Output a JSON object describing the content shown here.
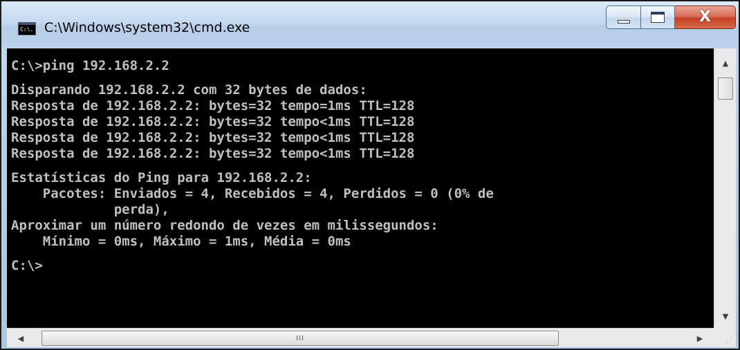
{
  "window": {
    "title": "C:\\Windows\\system32\\cmd.exe",
    "icon_label": "C:\\."
  },
  "caption_buttons": {
    "close_glyph": "X"
  },
  "console": {
    "lines": [
      "C:\\>ping 192.168.2.2",
      "",
      "Disparando 192.168.2.2 com 32 bytes de dados:",
      "Resposta de 192.168.2.2: bytes=32 tempo=1ms TTL=128",
      "Resposta de 192.168.2.2: bytes=32 tempo<1ms TTL=128",
      "Resposta de 192.168.2.2: bytes=32 tempo<1ms TTL=128",
      "Resposta de 192.168.2.2: bytes=32 tempo<1ms TTL=128",
      "",
      "Estatísticas do Ping para 192.168.2.2:",
      "    Pacotes: Enviados = 4, Recebidos = 4, Perdidos = 0 (0% de",
      "             perda),",
      "Aproximar um número redondo de vezes em milissegundos:",
      "    Mínimo = 0ms, Máximo = 1ms, Média = 0ms",
      "",
      "C:\\>"
    ]
  },
  "scrollbars": {
    "vertical": {
      "up_arrow": "▲",
      "down_arrow": "▼"
    },
    "horizontal": {
      "left_arrow": "◀",
      "right_arrow": "▶",
      "thumb_grip": "III"
    }
  },
  "colors": {
    "console_bg": "#000000",
    "console_fg": "#c0c0c0",
    "close_button": "#c74228"
  }
}
